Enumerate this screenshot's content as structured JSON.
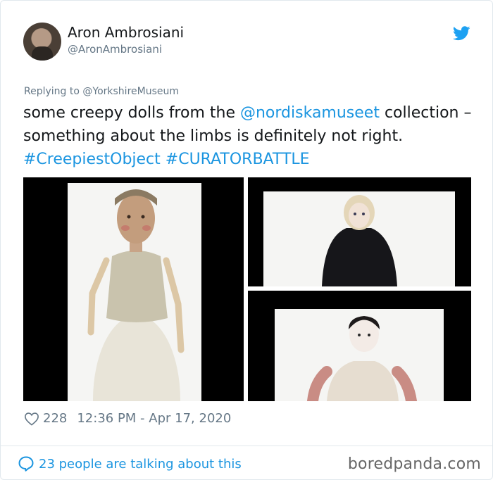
{
  "author": {
    "display_name": "Aron Ambrosiani",
    "handle": "@AronAmbrosiani",
    "avatar_icon": "user-avatar-photo"
  },
  "reply": {
    "prefix": "Replying to ",
    "target": "@YorkshireMuseum"
  },
  "tweet": {
    "text_1": "some creepy dolls from the ",
    "mention": "@nordiskamuseet",
    "text_2": " collection – something about the limbs is definitely not right. ",
    "hashtag_1": "#CreepiestObject",
    "hashtag_2": "#CURATORBATTLE"
  },
  "media": {
    "images": [
      {
        "subject": "wooden doll with pale dress"
      },
      {
        "subject": "porcelain doll in black coat"
      },
      {
        "subject": "porcelain doll with cloth limbs"
      }
    ]
  },
  "stats": {
    "likes": "228",
    "timestamp": "12:36 PM - Apr 17, 2020"
  },
  "footer": {
    "talking": "23 people are talking about this",
    "watermark": "boredpanda.com"
  },
  "colors": {
    "link": "#1b95e0",
    "muted": "#657786",
    "text": "#14171a"
  },
  "icons": {
    "brand": "twitter-bird-icon",
    "like": "heart-icon",
    "conversation": "speech-bubble-icon"
  }
}
